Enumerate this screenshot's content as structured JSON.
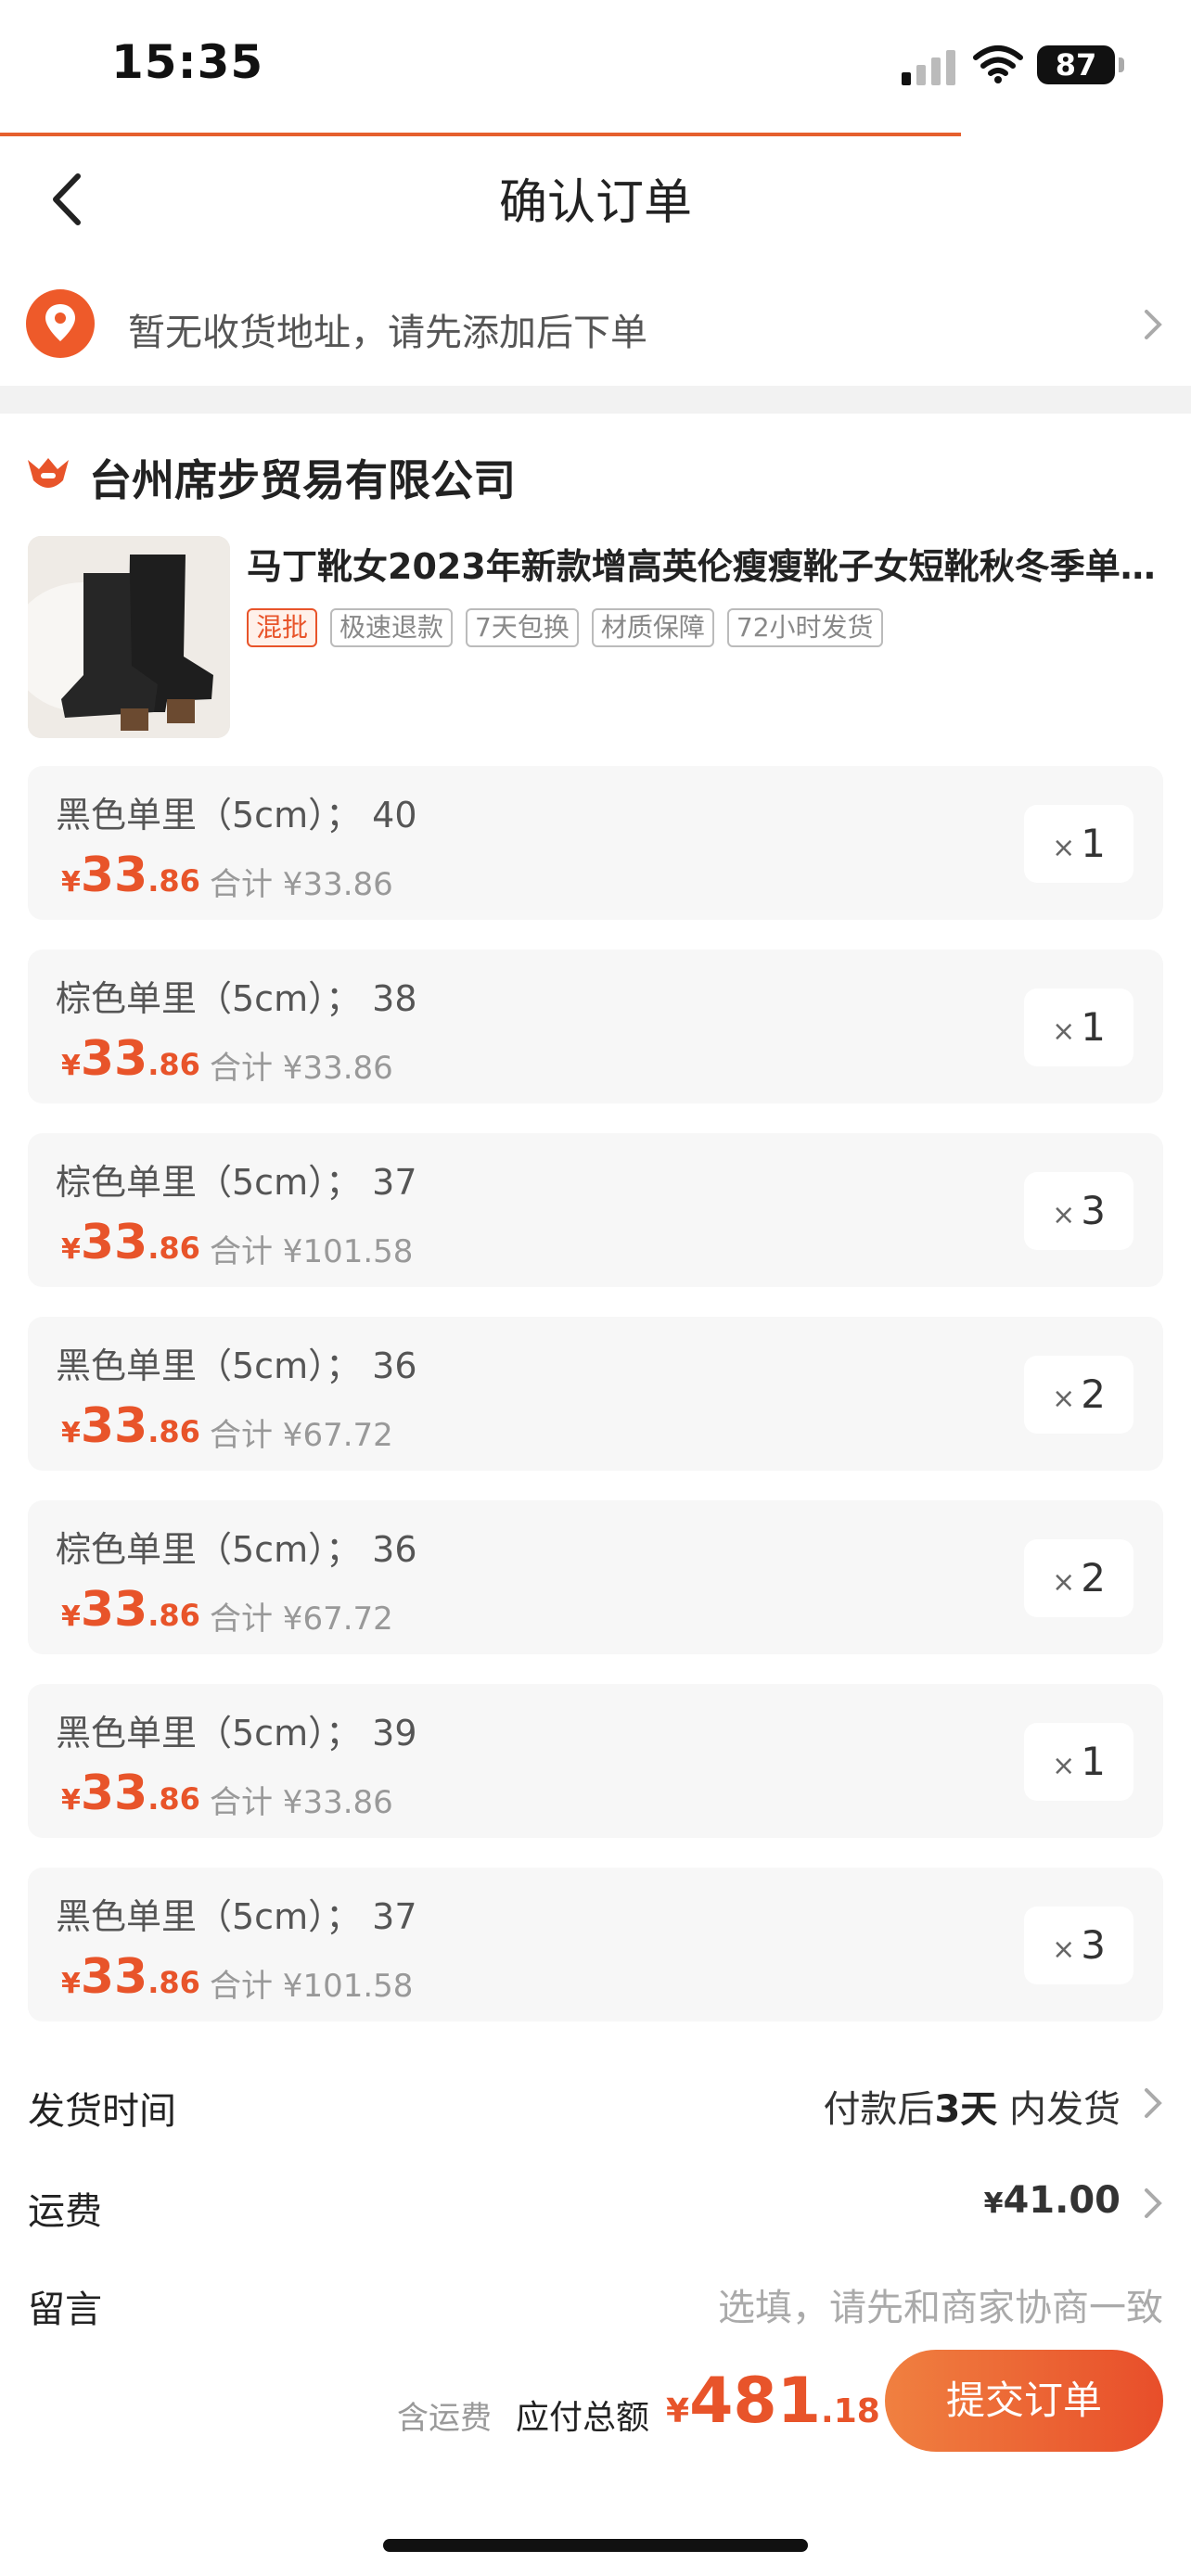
{
  "status": {
    "time": "15:35",
    "battery": "87"
  },
  "header": {
    "title": "确认订单"
  },
  "address": {
    "prompt": "暂无收货地址，请先添加后下单"
  },
  "shop": {
    "name": "台州席步贸易有限公司"
  },
  "product": {
    "title": "马丁靴女2023年新款增高英伦瘦瘦靴子女短靴秋冬季单…",
    "tags": [
      "混批",
      "极速退款",
      "7天包换",
      "材质保障",
      "72小时发货"
    ]
  },
  "price_parts": {
    "currency": "¥",
    "int": "33",
    "dec": ".86"
  },
  "skus": [
    {
      "spec": "黑色单里（5cm）； 40",
      "subtotal": "合计 ¥33.86",
      "qty": "1"
    },
    {
      "spec": "棕色单里（5cm）； 38",
      "subtotal": "合计 ¥33.86",
      "qty": "1"
    },
    {
      "spec": "棕色单里（5cm）； 37",
      "subtotal": "合计 ¥101.58",
      "qty": "3"
    },
    {
      "spec": "黑色单里（5cm）； 36",
      "subtotal": "合计 ¥67.72",
      "qty": "2"
    },
    {
      "spec": "棕色单里（5cm）； 36",
      "subtotal": "合计 ¥67.72",
      "qty": "2"
    },
    {
      "spec": "黑色单里（5cm）； 39",
      "subtotal": "合计 ¥33.86",
      "qty": "1"
    },
    {
      "spec": "黑色单里（5cm）； 37",
      "subtotal": "合计 ¥101.58",
      "qty": "3"
    }
  ],
  "qty_symbol": "×",
  "shipping_time": {
    "label": "发货时间",
    "prefix": "付款后",
    "days": "3天",
    "suffix": " 内发货"
  },
  "freight": {
    "label": "运费",
    "currency": "¥",
    "amount": "41.00"
  },
  "message": {
    "label": "留言",
    "placeholder": "选填，请先和商家协商一致"
  },
  "footer": {
    "note": "含运费",
    "total_label": "应付总额",
    "currency": "¥",
    "total_int": "481",
    "total_dec": ".18",
    "submit_label": "提交订单"
  },
  "colors": {
    "accent": "#e8542a",
    "background_band": "#f2f2f2",
    "card": "#f7f7f7"
  }
}
